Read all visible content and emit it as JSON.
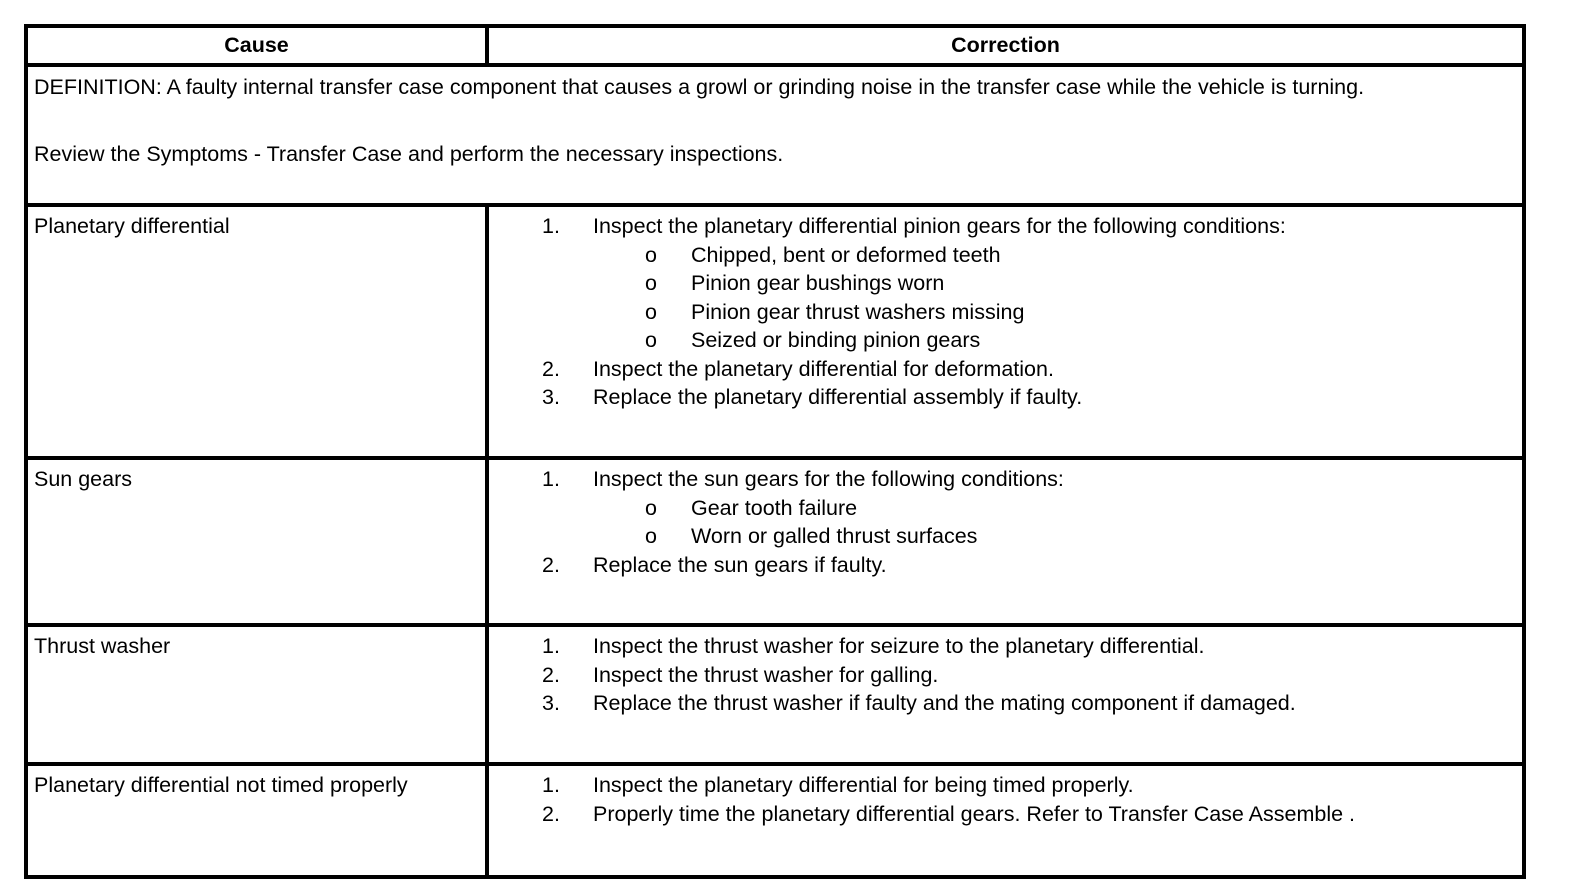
{
  "header": {
    "cause": "Cause",
    "correction": "Correction"
  },
  "definition": {
    "line1": "DEFINITION: A faulty internal transfer case component that causes a growl or grinding noise in the transfer case while the vehicle is turning.",
    "line2": "Review the Symptoms - Transfer Case and perform the necessary inspections."
  },
  "rows": [
    {
      "cause": "Planetary differential",
      "steps": [
        {
          "num": "1.",
          "text": "Inspect the planetary differential pinion gears for the following conditions:",
          "subs": [
            {
              "bullet": "o",
              "text": "Chipped, bent or deformed teeth"
            },
            {
              "bullet": "o",
              "text": "Pinion gear bushings worn"
            },
            {
              "bullet": "o",
              "text": "Pinion gear thrust washers missing"
            },
            {
              "bullet": "o",
              "text": "Seized or binding pinion gears"
            }
          ]
        },
        {
          "num": "2.",
          "text": "Inspect the planetary differential for deformation."
        },
        {
          "num": "3.",
          "text": "Replace the planetary differential assembly if faulty."
        }
      ]
    },
    {
      "cause": "Sun gears",
      "steps": [
        {
          "num": "1.",
          "text": "Inspect the sun gears for the following conditions:",
          "subs": [
            {
              "bullet": "o",
              "text": "Gear tooth failure"
            },
            {
              "bullet": "o",
              "text": "Worn or galled thrust surfaces"
            }
          ]
        },
        {
          "num": "2.",
          "text": "Replace the sun gears if faulty."
        }
      ]
    },
    {
      "cause": "Thrust washer",
      "steps": [
        {
          "num": "1.",
          "text": "Inspect the thrust washer for seizure to the planetary differential."
        },
        {
          "num": "2.",
          "text": "Inspect the thrust washer for galling."
        },
        {
          "num": "3.",
          "text": "Replace the thrust washer if faulty and the mating component if damaged."
        }
      ]
    },
    {
      "cause": "Planetary differential not timed properly",
      "steps": [
        {
          "num": "1.",
          "text": "Inspect the planetary differential for being timed properly."
        },
        {
          "num": "2.",
          "text": "Properly time the planetary differential gears. Refer to Transfer Case Assemble ."
        }
      ]
    }
  ]
}
